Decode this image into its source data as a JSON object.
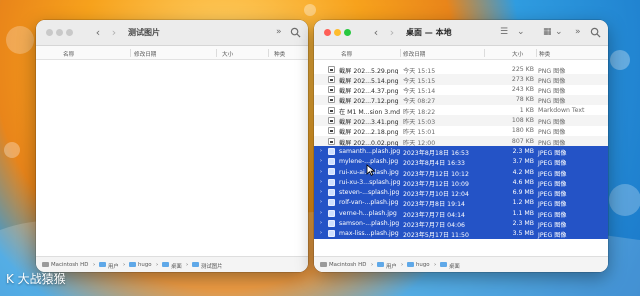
{
  "colors": {
    "selection": "#2453c6",
    "folder": "#5fa8e8"
  },
  "left_window": {
    "title": "测试图片",
    "headers": {
      "name": "名称",
      "date": "修改日期",
      "size": "大小",
      "kind": "种类"
    },
    "toolbar_more": "»",
    "path": [
      "Macintosh HD",
      "用户",
      "hugo",
      "桌面",
      "测试图片"
    ]
  },
  "right_window": {
    "title": "桌面 — 本地",
    "headers": {
      "name": "名称",
      "date": "修改日期",
      "size": "大小",
      "kind": "种类"
    },
    "toolbar_more": "»",
    "files": [
      {
        "name": "截屏 202...5.29.png",
        "date": "今天 15:15",
        "size": "225 KB",
        "kind": "PNG 图像",
        "selected": false,
        "icon": "image-file-icon"
      },
      {
        "name": "截屏 202...5.14.png",
        "date": "今天 15:15",
        "size": "273 KB",
        "kind": "PNG 图像",
        "selected": false,
        "icon": "image-file-icon"
      },
      {
        "name": "截屏 202...4.37.png",
        "date": "今天 15:14",
        "size": "243 KB",
        "kind": "PNG 图像",
        "selected": false,
        "icon": "image-file-icon"
      },
      {
        "name": "截屏 202...7.12.png",
        "date": "今天 08:27",
        "size": "78 KB",
        "kind": "PNG 图像",
        "selected": false,
        "icon": "image-file-icon"
      },
      {
        "name": "在 M1 M...sion 3.md",
        "date": "昨天 18:22",
        "size": "1 KB",
        "kind": "Markdown Text",
        "selected": false,
        "icon": "text-file-icon"
      },
      {
        "name": "截屏 202...3.41.png",
        "date": "昨天 15:03",
        "size": "108 KB",
        "kind": "PNG 图像",
        "selected": false,
        "icon": "image-file-icon"
      },
      {
        "name": "截屏 202...2.18.png",
        "date": "昨天 15:01",
        "size": "180 KB",
        "kind": "PNG 图像",
        "selected": false,
        "icon": "image-file-icon"
      },
      {
        "name": "截屏 202...0.02.png",
        "date": "昨天 12:00",
        "size": "807 KB",
        "kind": "PNG 图像",
        "selected": false,
        "icon": "image-file-icon"
      },
      {
        "name": "samanth...plash.jpg",
        "date": "2023年8月18日 16:53",
        "size": "2.3 MB",
        "kind": "JPEG 图像",
        "selected": true,
        "icon": "photo-file-icon"
      },
      {
        "name": "mylene-...plash.jpg",
        "date": "2023年8月4日 16:33",
        "size": "3.7 MB",
        "kind": "JPEG 图像",
        "selected": true,
        "icon": "photo-file-icon"
      },
      {
        "name": "rui-xu-ai...plash.jpg",
        "date": "2023年7月12日 10:12",
        "size": "4.2 MB",
        "kind": "JPEG 图像",
        "selected": true,
        "icon": "photo-file-icon"
      },
      {
        "name": "rui-xu-3...splash.jpg",
        "date": "2023年7月12日 10:09",
        "size": "4.6 MB",
        "kind": "JPEG 图像",
        "selected": true,
        "icon": "photo-file-icon"
      },
      {
        "name": "steven-...splash.jpg",
        "date": "2023年7月10日 12:04",
        "size": "6.9 MB",
        "kind": "JPEG 图像",
        "selected": true,
        "icon": "photo-file-icon"
      },
      {
        "name": "rolf-van-...plash.jpg",
        "date": "2023年7月8日 19:14",
        "size": "1.2 MB",
        "kind": "JPEG 图像",
        "selected": true,
        "icon": "photo-file-icon"
      },
      {
        "name": "verne-h...plash.jpg",
        "date": "2023年7月7日 04:14",
        "size": "1.1 MB",
        "kind": "JPEG 图像",
        "selected": true,
        "icon": "photo-file-icon"
      },
      {
        "name": "samson-...plash.jpg",
        "date": "2023年7月7日 04:06",
        "size": "2.3 MB",
        "kind": "JPEG 图像",
        "selected": true,
        "icon": "photo-file-icon"
      },
      {
        "name": "max-liss...plash.jpg",
        "date": "2023年5月17日 11:50",
        "size": "3.5 MB",
        "kind": "JPEG 图像",
        "selected": true,
        "icon": "photo-file-icon"
      }
    ],
    "path": [
      "Macintosh HD",
      "用户",
      "hugo",
      "桌面"
    ]
  },
  "watermark": "K 大战猿猴"
}
